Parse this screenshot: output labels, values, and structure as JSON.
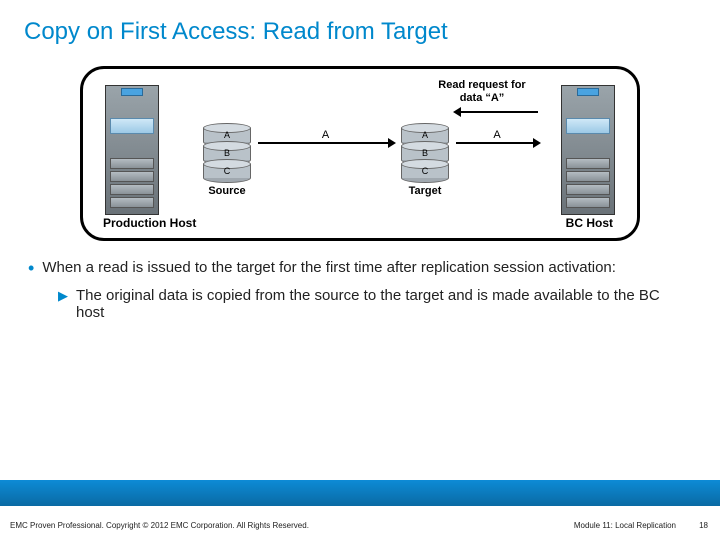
{
  "title": "Copy on First Access: Read from Target",
  "diagram": {
    "source": {
      "rows": [
        "A",
        "B",
        "C"
      ],
      "caption": "Source"
    },
    "target": {
      "rows": [
        "A",
        "B",
        "C"
      ],
      "caption": "Target"
    },
    "arrow1_label": "A",
    "arrow2_label": "A",
    "request_label": "Read request for data “A”",
    "production_host": "Production Host",
    "bc_host": "BC Host"
  },
  "bullet1": "When a read is issued to the target for the first time after replication session activation:",
  "bullet2": "The original data is copied from the source to the target and is made available to the BC host",
  "footer": {
    "copyright": "EMC Proven Professional. Copyright © 2012 EMC Corporation. All Rights Reserved.",
    "module": "Module 11: Local Replication",
    "page": "18"
  }
}
